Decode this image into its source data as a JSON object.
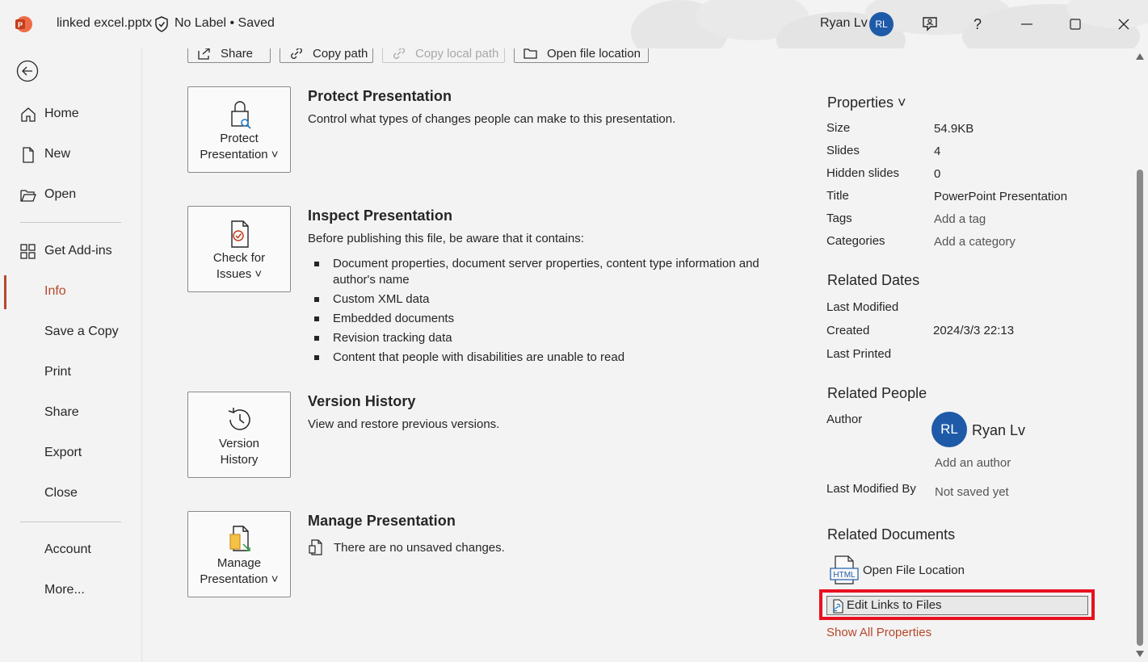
{
  "window": {
    "filename": "linked excel.pptx",
    "label_status": "No Label • Saved",
    "username": "Ryan Lv",
    "user_initials": "RL"
  },
  "nav": {
    "items": [
      {
        "label": "Home",
        "icon": "home-icon"
      },
      {
        "label": "New",
        "icon": "new-document-icon"
      },
      {
        "label": "Open",
        "icon": "folder-open-icon"
      },
      {
        "label": "Get Add-ins",
        "icon": "add-ins-grid-icon"
      },
      {
        "label": "Info"
      },
      {
        "label": "Save a Copy"
      },
      {
        "label": "Print"
      },
      {
        "label": "Share"
      },
      {
        "label": "Export"
      },
      {
        "label": "Close"
      },
      {
        "label": "Account"
      },
      {
        "label": "More..."
      }
    ],
    "active": "Info"
  },
  "top_buttons": {
    "share": "Share",
    "copy_path": "Copy path",
    "copy_local_path": "Copy local path",
    "open_file_location": "Open file location"
  },
  "sections": {
    "protect": {
      "button_line1": "Protect",
      "button_line2": "Presentation ˅",
      "title": "Protect Presentation",
      "desc": "Control what types of changes people can make to this presentation."
    },
    "inspect": {
      "button_line1": "Check for",
      "button_line2": "Issues ˅",
      "title": "Inspect Presentation",
      "desc": "Before publishing this file, be aware that it contains:",
      "bullets": [
        "Document properties, document server properties, content type information and author's name",
        "Custom XML data",
        "Embedded documents",
        "Revision tracking data",
        "Content that people with disabilities are unable to read"
      ]
    },
    "version": {
      "button_line1": "Version",
      "button_line2": "History",
      "title": "Version History",
      "desc": "View and restore previous versions."
    },
    "manage": {
      "button_line1": "Manage",
      "button_line2": "Presentation ˅",
      "title": "Manage Presentation",
      "desc": "There are no unsaved changes."
    }
  },
  "properties": {
    "header": "Properties ˅",
    "rows": [
      {
        "label": "Size",
        "value": "54.9KB"
      },
      {
        "label": "Slides",
        "value": "4"
      },
      {
        "label": "Hidden slides",
        "value": "0"
      },
      {
        "label": "Title",
        "value": "PowerPoint Presentation"
      },
      {
        "label": "Tags",
        "value": "Add a tag"
      },
      {
        "label": "Categories",
        "value": "Add a category"
      }
    ],
    "related_dates": {
      "header": "Related Dates",
      "last_modified_label": "Last Modified",
      "created_label": "Created",
      "created_value": "2024/3/3 22:13",
      "last_printed_label": "Last Printed"
    },
    "related_people": {
      "header": "Related People",
      "author_label": "Author",
      "author_initials": "RL",
      "author_name": "Ryan Lv",
      "add_author": "Add an author",
      "last_modified_by_label": "Last Modified By",
      "last_modified_by_value": "Not saved yet"
    },
    "related_documents": {
      "header": "Related Documents",
      "open_file_location": "Open File Location",
      "edit_links": "Edit Links to Files",
      "show_all": "Show All Properties"
    }
  },
  "colors": {
    "accent": "#b7472a",
    "avatar": "#1e5aa8",
    "highlight": "#e8101f",
    "background": "#f3f3f3"
  }
}
